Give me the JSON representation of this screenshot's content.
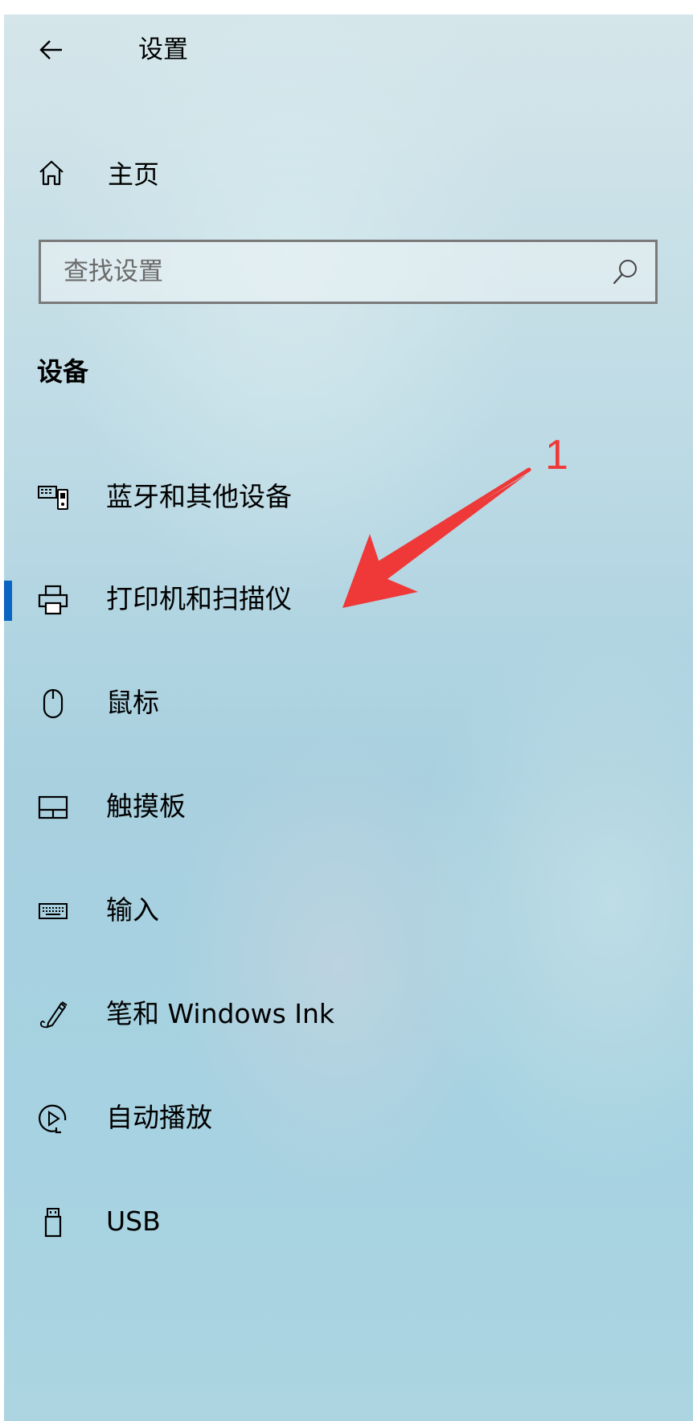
{
  "window": {
    "title": "设置",
    "back_icon": "back-arrow-icon"
  },
  "home": {
    "label": "主页",
    "icon": "home-icon"
  },
  "search": {
    "placeholder": "查找设置",
    "value": "",
    "icon": "search-icon"
  },
  "section": {
    "title": "设备"
  },
  "nav": {
    "selected_index": 1,
    "accent_color": "#0a64c2",
    "items": [
      {
        "label": "蓝牙和其他设备",
        "icon": "bluetooth-devices-icon"
      },
      {
        "label": "打印机和扫描仪",
        "icon": "printer-icon"
      },
      {
        "label": "鼠标",
        "icon": "mouse-icon"
      },
      {
        "label": "触摸板",
        "icon": "touchpad-icon"
      },
      {
        "label": "输入",
        "icon": "keyboard-icon"
      },
      {
        "label": "笔和 Windows Ink",
        "icon": "pen-icon"
      },
      {
        "label": "自动播放",
        "icon": "autoplay-icon"
      },
      {
        "label": "USB",
        "icon": "usb-icon"
      }
    ]
  },
  "annotation": {
    "number": "1",
    "color": "#ef3838"
  }
}
